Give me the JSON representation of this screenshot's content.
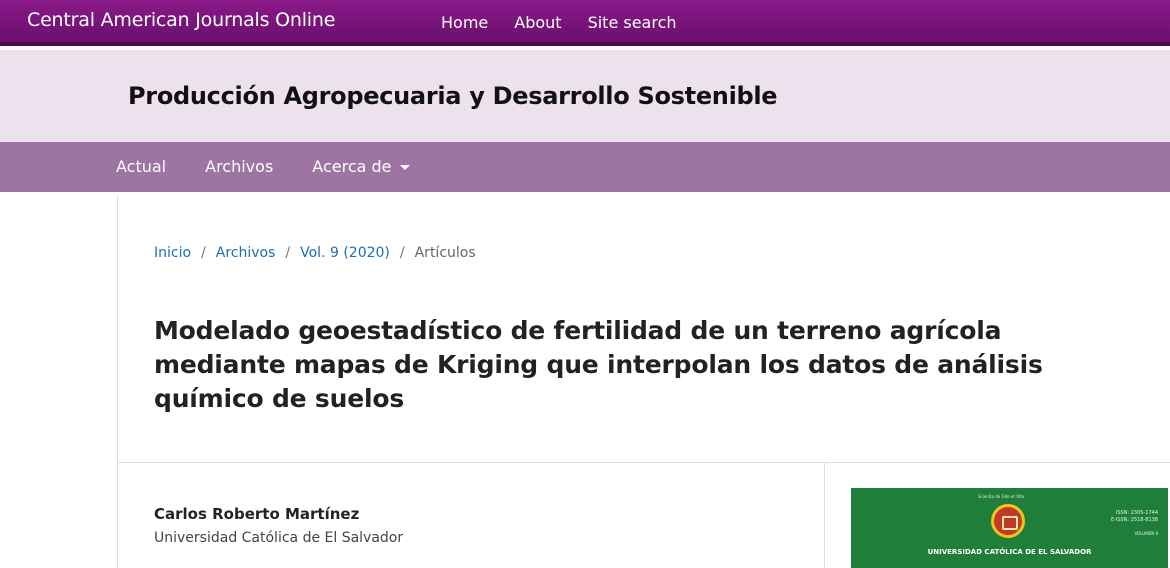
{
  "site": {
    "title": "Central American Journals Online",
    "nav": [
      "Home",
      "About",
      "Site search"
    ]
  },
  "journal": {
    "title": "Producción Agropecuaria y Desarrollo Sostenible"
  },
  "main_nav": {
    "items": [
      "Actual",
      "Archivos",
      "Acerca de"
    ]
  },
  "breadcrumb": {
    "home": "Inicio",
    "archives": "Archivos",
    "issue": "Vol. 9 (2020)",
    "current": "Artículos",
    "separator": "/"
  },
  "article": {
    "title": "Modelado geoestadístico de fertilidad de un terreno agrícola mediante mapas de Kriging que interpolan los datos de análisis químico de suelos"
  },
  "author": {
    "name": "Carlos Roberto Martínez",
    "affiliation": "Universidad Católica de El Salvador"
  },
  "cover": {
    "motto": "Scientia de Fide et Vita",
    "issn": "ISSN: 2305-1744",
    "eissn": "E-ISSN: 2518-8138",
    "volume": "VOLUMEN 9",
    "university": "UNIVERSIDAD CATÓLICA DE EL SALVADOR"
  },
  "colors": {
    "topbar": "#7a167c",
    "journal_band": "#ece1ec",
    "main_nav": "#9e74a3",
    "link": "#1b6fb4",
    "cover": "#1f7f3a"
  }
}
